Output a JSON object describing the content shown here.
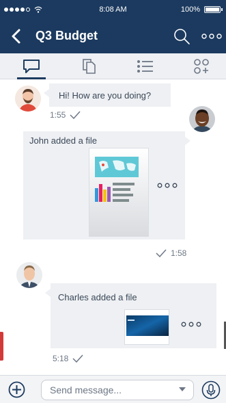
{
  "status": {
    "time": "8:08 AM",
    "battery": "100%"
  },
  "header": {
    "title": "Q3 Budget"
  },
  "tabs": [
    {
      "name": "chat-icon",
      "active": true
    },
    {
      "name": "files-icon",
      "active": false
    },
    {
      "name": "list-icon",
      "active": false
    },
    {
      "name": "apps-icon",
      "active": false
    }
  ],
  "messages": [
    {
      "text": "Hi! How are you doing?",
      "time": "1:55"
    },
    {
      "text": "John added a file",
      "time": "1:58"
    },
    {
      "text": "Charles added a file",
      "time": "5:18"
    }
  ],
  "composer": {
    "placeholder": "Send message..."
  },
  "colors": {
    "header": "#1c3a5f",
    "bubble": "#eef0f3",
    "accent": "#d23a3a"
  }
}
